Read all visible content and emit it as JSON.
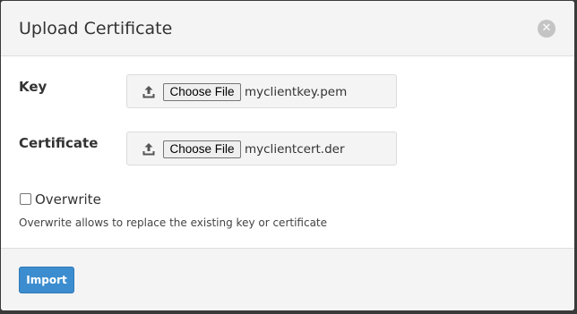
{
  "dialog": {
    "title": "Upload Certificate",
    "close_icon": "close-icon"
  },
  "fields": {
    "key": {
      "label": "Key",
      "button_label": "Choose File",
      "file_name": "myclientkey.pem",
      "icon": "upload-icon"
    },
    "certificate": {
      "label": "Certificate",
      "button_label": "Choose File",
      "file_name": "myclientcert.der",
      "icon": "upload-icon"
    }
  },
  "overwrite": {
    "label": "Overwrite",
    "checked": false,
    "help": "Overwrite allows to replace the existing key or certificate"
  },
  "footer": {
    "import_label": "Import"
  },
  "colors": {
    "primary": "#3c8dcf",
    "header_bg": "#f4f4f4",
    "close_bg": "#c4c4c4"
  }
}
